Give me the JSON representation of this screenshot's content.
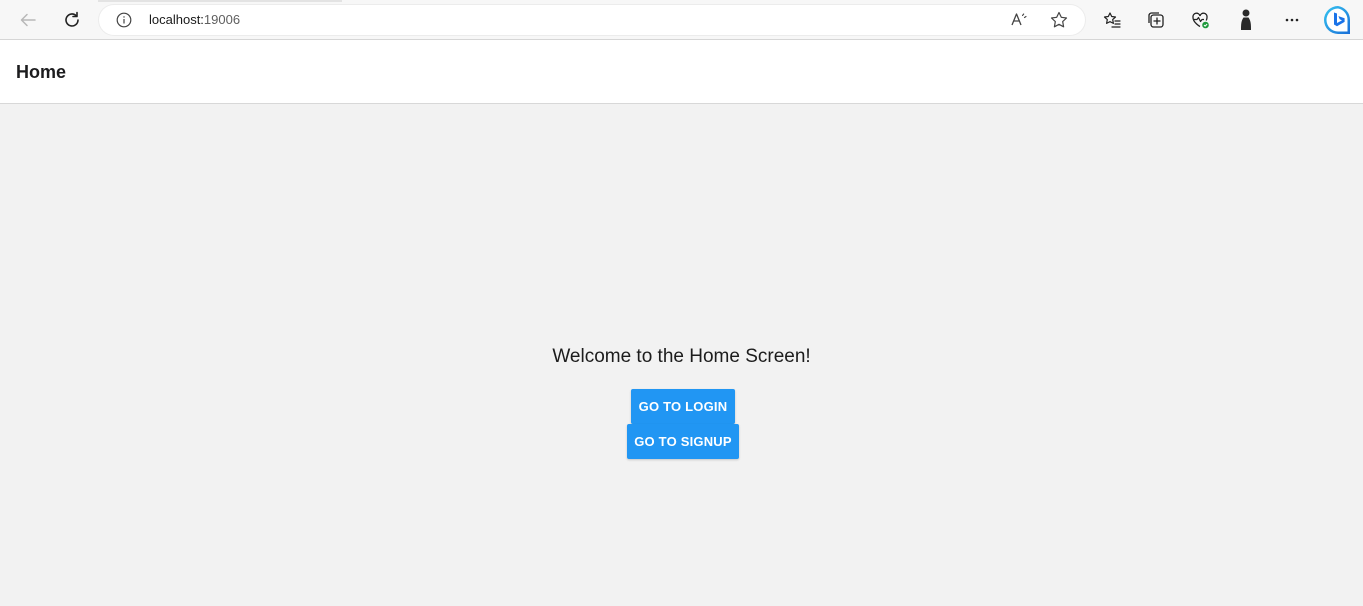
{
  "browser": {
    "url_host": "localhost:",
    "url_port": "19006",
    "icons": {
      "back": "back-arrow-icon",
      "refresh": "refresh-icon",
      "info": "site-info-icon",
      "read_aloud": "read-aloud-icon",
      "favorite": "favorite-star-icon",
      "favorites": "favorites-list-icon",
      "collections": "collections-icon",
      "performance": "browser-essentials-icon",
      "profile": "profile-icon",
      "more": "more-options-icon",
      "bing": "bing-chat-icon"
    }
  },
  "app": {
    "header_title": "Home",
    "welcome_text": "Welcome to the Home Screen!",
    "login_button_label": "GO TO LOGIN",
    "signup_button_label": "GO TO SIGNUP"
  },
  "colors": {
    "accent": "#2196f3",
    "background": "#f2f2f2",
    "header_bg": "#ffffff"
  }
}
